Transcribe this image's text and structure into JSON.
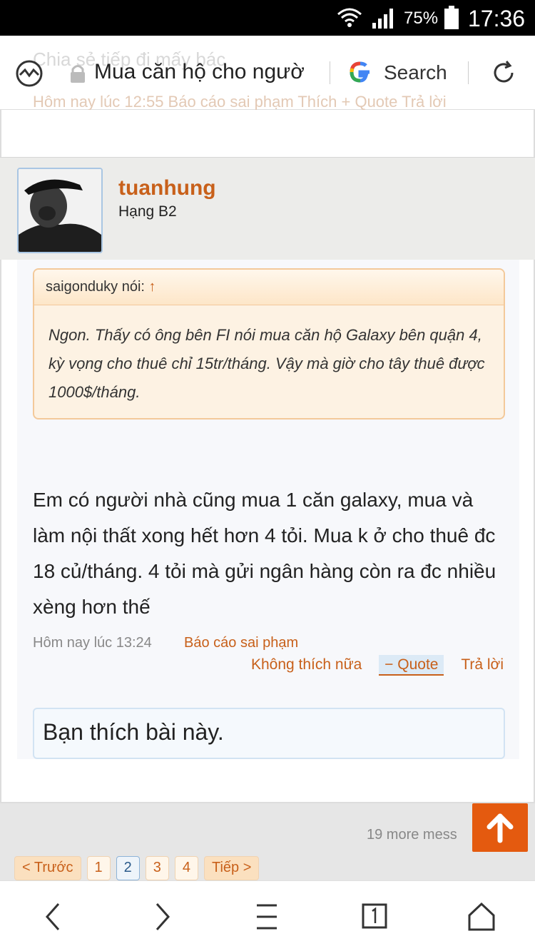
{
  "status": {
    "battery_pct": "75%",
    "time": "17:36"
  },
  "browser": {
    "url": "Mua căn hộ cho ngườ",
    "search_label": "Search",
    "ghost_title": "Chia sẻ tiếp đi mấy bác",
    "ghost_links": "Hôm nay lúc 12:55   Báo cáo sai phạm   Thích   + Quote   Trả lời"
  },
  "post": {
    "username": "tuanhung",
    "rank": "Hạng B2",
    "quote": {
      "author": "saigonduky nói: ",
      "arrow": "↑",
      "text": "Ngon. Thấy có ông bên FI nói mua căn hộ Galaxy bên quận 4, kỳ vọng cho thuê chỉ 15tr/tháng. Vậy mà giờ cho tây thuê được 1000$/tháng."
    },
    "message": "Em có người nhà cũng mua 1 căn galaxy, mua và làm nội thất xong hết hơn 4 tỏi. Mua k ở cho thuê đc 18 củ/tháng. 4 tỏi mà gửi ngân hàng còn ra đc nhiều xèng hơn thế",
    "time": "Hôm nay lúc 13:24",
    "report": "Báo cáo sai phạm",
    "unlike": "Không thích nữa",
    "quote_btn": "− Quote",
    "reply": "Trả lời",
    "like_text": "Bạn thích bài này."
  },
  "more_messages": "19 more mess",
  "pagination": {
    "prev": "< Trước",
    "pages": [
      "1",
      "2",
      "3",
      "4"
    ],
    "current": "2",
    "next": "Tiếp >"
  },
  "colors": {
    "accent": "#c8601a",
    "scroll_top": "#e45a0f"
  }
}
